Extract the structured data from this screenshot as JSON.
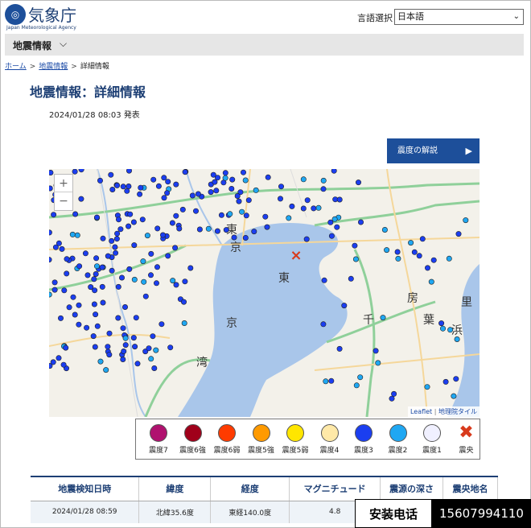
{
  "header": {
    "logo_name": "気象庁",
    "logo_en": "Japan Meteorological Agency",
    "language_label": "言語選択",
    "language_value": "日本語"
  },
  "nav": {
    "title": "地震情報"
  },
  "breadcrumb": {
    "home": "ホーム",
    "eq": "地震情報",
    "current": "詳細情報"
  },
  "page": {
    "title": "地震情報：詳細情報",
    "announce": "2024/01/28 08:03 発表",
    "explain_button": "震度の解説"
  },
  "map": {
    "zoom_in": "+",
    "zoom_out": "−",
    "attribution_leaflet": "Leaflet",
    "attribution_sep": "|",
    "attribution_tiles": "地理院タイル",
    "place_chars": [
      "東",
      "京",
      "東",
      "京",
      "湾",
      "千",
      "房",
      "葉",
      "里",
      "浜"
    ],
    "epicenter_mark": "×"
  },
  "legend": [
    {
      "label": "震度7",
      "color": "#b0116f"
    },
    {
      "label": "震度6強",
      "color": "#a0001a"
    },
    {
      "label": "震度6弱",
      "color": "#ff3b00"
    },
    {
      "label": "震度5強",
      "color": "#ff9a00"
    },
    {
      "label": "震度5弱",
      "color": "#ffe600"
    },
    {
      "label": "震度4",
      "color": "#ffe9a8"
    },
    {
      "label": "震度3",
      "color": "#1b3ef0"
    },
    {
      "label": "震度2",
      "color": "#1fa7f2"
    },
    {
      "label": "震度1",
      "color": "#f0f0ff"
    },
    {
      "label": "震央",
      "color": "#d83a1c"
    }
  ],
  "table": {
    "headers": [
      "地震検知日時",
      "緯度",
      "経度",
      "マグニチュード",
      "震源の深さ",
      "震央地名"
    ],
    "row": [
      "2024/01/28 08:59",
      "北緯35.6度",
      "東経140.0度",
      "4.8",
      "",
      ""
    ]
  },
  "overlay": {
    "label": "安装电话",
    "phone": "15607994110"
  }
}
